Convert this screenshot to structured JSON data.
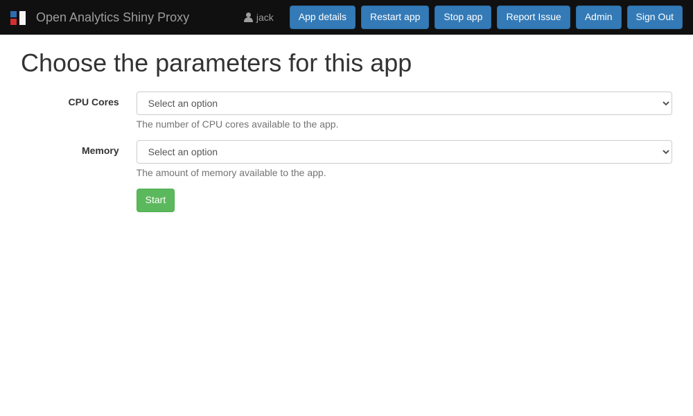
{
  "nav": {
    "brand": "Open Analytics Shiny Proxy",
    "username": "jack",
    "buttons": {
      "app_details": "App details",
      "restart_app": "Restart app",
      "stop_app": "Stop app",
      "report_issue": "Report Issue",
      "admin": "Admin",
      "sign_out": "Sign Out"
    }
  },
  "page": {
    "title": "Choose the parameters for this app"
  },
  "form": {
    "cpu": {
      "label": "CPU Cores",
      "placeholder": "Select an option",
      "help": "The number of CPU cores available to the app."
    },
    "memory": {
      "label": "Memory",
      "placeholder": "Select an option",
      "help": "The amount of memory available to the app."
    },
    "submit": "Start"
  }
}
